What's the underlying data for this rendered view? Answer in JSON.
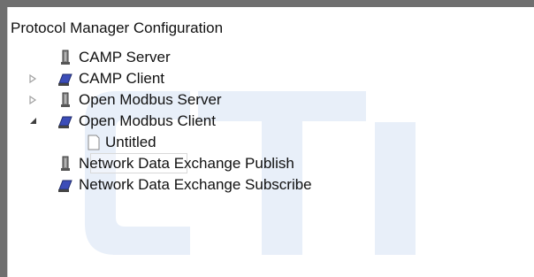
{
  "header": {
    "title": "Protocol Manager Configuration"
  },
  "tree": {
    "items": [
      {
        "label": "CAMP Server",
        "icon": "server-icon",
        "expander": "none"
      },
      {
        "label": "CAMP Client",
        "icon": "client-icon",
        "expander": "collapsed"
      },
      {
        "label": "Open Modbus Server",
        "icon": "server-icon",
        "expander": "collapsed"
      },
      {
        "label": "Open Modbus Client",
        "icon": "client-icon",
        "expander": "expanded"
      },
      {
        "label": "Untitled",
        "icon": "document-icon",
        "expander": "none"
      },
      {
        "label": "Network Data Exchange Publish",
        "icon": "server-icon",
        "expander": "none"
      },
      {
        "label": "Network Data Exchange Subscribe",
        "icon": "client-icon",
        "expander": "none"
      }
    ]
  },
  "colors": {
    "watermark": "#e8eff9",
    "frame": "#6f6f6f",
    "expander_collapsed": "#a0a0a0",
    "expander_expanded": "#3f3f3f",
    "client_icon": "#3c4db8"
  }
}
